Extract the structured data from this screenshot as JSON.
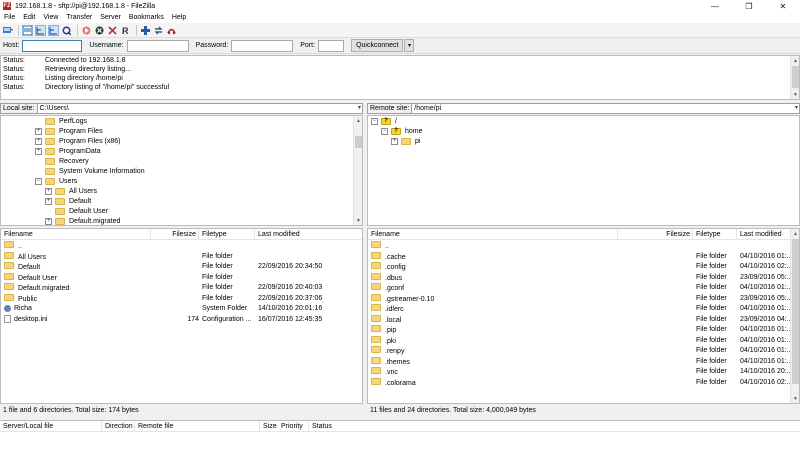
{
  "window": {
    "title": "192.168.1.8 - sftp://pi@192.168.1.8 - FileZilla",
    "app_icon": "FZ",
    "minimize": "—",
    "maximize": "❐",
    "close": "✕"
  },
  "menu": [
    "File",
    "Edit",
    "View",
    "Transfer",
    "Server",
    "Bookmarks",
    "Help"
  ],
  "toolbar": {
    "icons": [
      "site-manager-icon",
      "toggle-log-icon",
      "toggle-local-tree-icon",
      "toggle-remote-tree-icon",
      "refresh-icon",
      "process-queue-icon",
      "cancel-icon",
      "disconnect-icon",
      "reconnect-icon",
      "filter-icon",
      "sync-browse-icon",
      "search-icon"
    ]
  },
  "quickconnect": {
    "host_label": "Host:",
    "host_value": "",
    "username_label": "Username:",
    "username_value": "",
    "password_label": "Password:",
    "password_value": "",
    "port_label": "Port:",
    "port_value": "",
    "button": "Quickconnect",
    "dropdown": "▾"
  },
  "log": [
    {
      "label": "Status:",
      "text": "Connected to 192.168.1.8"
    },
    {
      "label": "Status:",
      "text": "Retrieving directory listing..."
    },
    {
      "label": "Status:",
      "text": "Listing directory /home/pi"
    },
    {
      "label": "Status:",
      "text": "Directory listing of \"/home/pi\" successful"
    }
  ],
  "local": {
    "site_label": "Local site:",
    "path": "C:\\Users\\",
    "tree": [
      {
        "label": "PerfLogs",
        "level": 1,
        "expander": ""
      },
      {
        "label": "Program Files",
        "level": 1,
        "expander": "+"
      },
      {
        "label": "Program Files (x86)",
        "level": 1,
        "expander": "+"
      },
      {
        "label": "ProgramData",
        "level": 1,
        "expander": "+"
      },
      {
        "label": "Recovery",
        "level": 1,
        "expander": ""
      },
      {
        "label": "System Volume Information",
        "level": 1,
        "expander": ""
      },
      {
        "label": "Users",
        "level": 1,
        "expander": "−"
      },
      {
        "label": "All Users",
        "level": 2,
        "expander": "+"
      },
      {
        "label": "Default",
        "level": 2,
        "expander": "+"
      },
      {
        "label": "Default User",
        "level": 2,
        "expander": ""
      },
      {
        "label": "Default.migrated",
        "level": 2,
        "expander": "+"
      }
    ],
    "columns": [
      "Filename",
      "Filesize",
      "Filetype",
      "Last modified"
    ],
    "files": [
      {
        "name": "..",
        "size": "",
        "type": "",
        "modified": "",
        "icon": "folder"
      },
      {
        "name": "All Users",
        "size": "",
        "type": "File folder",
        "modified": "",
        "icon": "folder"
      },
      {
        "name": "Default",
        "size": "",
        "type": "File folder",
        "modified": "22/09/2016 20:34:50",
        "icon": "folder"
      },
      {
        "name": "Default User",
        "size": "",
        "type": "File folder",
        "modified": "",
        "icon": "folder"
      },
      {
        "name": "Default.migrated",
        "size": "",
        "type": "File folder",
        "modified": "22/09/2016 20:40:03",
        "icon": "folder"
      },
      {
        "name": "Public",
        "size": "",
        "type": "File folder",
        "modified": "22/09/2016 20:37:06",
        "icon": "folder"
      },
      {
        "name": "Richa",
        "size": "",
        "type": "System Folder",
        "modified": "14/10/2016 20:01:16",
        "icon": "user"
      },
      {
        "name": "desktop.ini",
        "size": "174",
        "type": "Configuration ...",
        "modified": "16/07/2016 12:45:35",
        "icon": "file"
      }
    ],
    "status": "1 file and 6 directories. Total size: 174 bytes"
  },
  "remote": {
    "site_label": "Remote site:",
    "path": "/home/pi",
    "tree": [
      {
        "label": "/",
        "level": 0,
        "expander": "−",
        "question": true
      },
      {
        "label": "home",
        "level": 1,
        "expander": "−",
        "question": true
      },
      {
        "label": "pi",
        "level": 2,
        "expander": "+",
        "question": false
      }
    ],
    "columns": [
      "Filename",
      "Filesize",
      "Filetype",
      "Last modified"
    ],
    "files": [
      {
        "name": "..",
        "type": "",
        "modified": ""
      },
      {
        "name": ".cache",
        "type": "File folder",
        "modified": "04/10/2016 01:..."
      },
      {
        "name": ".config",
        "type": "File folder",
        "modified": "04/10/2016 02:..."
      },
      {
        "name": ".dbus",
        "type": "File folder",
        "modified": "23/09/2016 05:..."
      },
      {
        "name": ".gconf",
        "type": "File folder",
        "modified": "04/10/2016 01:..."
      },
      {
        "name": ".gstreamer-0.10",
        "type": "File folder",
        "modified": "23/09/2016 05:..."
      },
      {
        "name": ".idlerc",
        "type": "File folder",
        "modified": "04/10/2016 01:..."
      },
      {
        "name": ".local",
        "type": "File folder",
        "modified": "23/09/2016 04:..."
      },
      {
        "name": ".pip",
        "type": "File folder",
        "modified": "04/10/2016 01:..."
      },
      {
        "name": ".pki",
        "type": "File folder",
        "modified": "04/10/2016 01:..."
      },
      {
        "name": ".renpy",
        "type": "File folder",
        "modified": "04/10/2016 01:..."
      },
      {
        "name": ".themes",
        "type": "File folder",
        "modified": "04/10/2016 01:..."
      },
      {
        "name": ".vnc",
        "type": "File folder",
        "modified": "14/10/2016 20:..."
      },
      {
        "name": ".colorama",
        "type": "File folder",
        "modified": "04/10/2016 02:..."
      }
    ],
    "status": "11 files and 24 directories. Total size: 4,000,049 bytes"
  },
  "queue": {
    "columns": [
      "Server/Local file",
      "Direction",
      "Remote file",
      "Size",
      "Priority",
      "Status"
    ]
  }
}
